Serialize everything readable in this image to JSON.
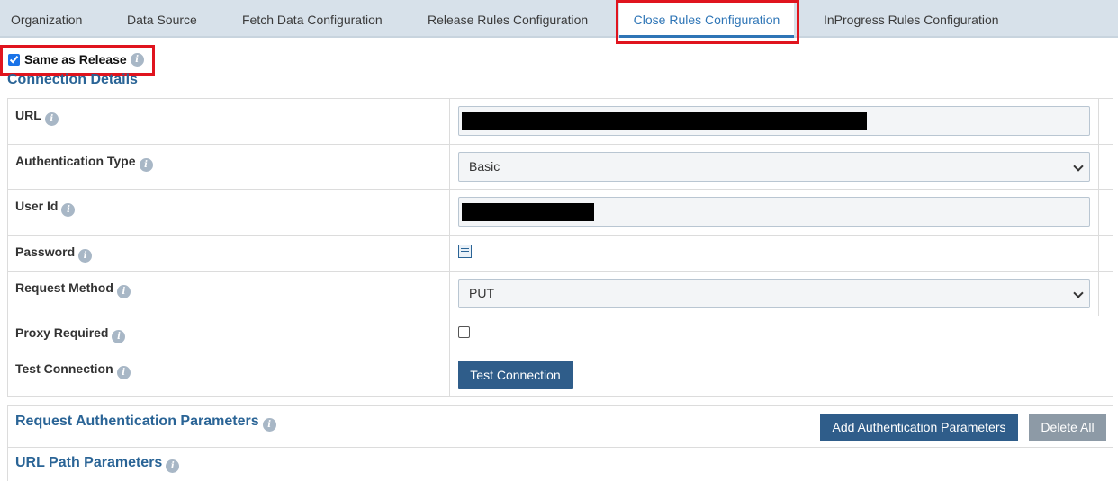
{
  "tabs": [
    {
      "label": "Organization"
    },
    {
      "label": "Data Source"
    },
    {
      "label": "Fetch Data Configuration"
    },
    {
      "label": "Release Rules Configuration"
    },
    {
      "label": "Close Rules Configuration",
      "active": true
    },
    {
      "label": "InProgress Rules Configuration"
    }
  ],
  "same_as_release": {
    "label": "Same as Release",
    "checked": true
  },
  "connection": {
    "title": "Connection Details",
    "url_label": "URL",
    "auth_type_label": "Authentication Type",
    "auth_type_value": "Basic",
    "user_id_label": "User Id",
    "password_label": "Password",
    "request_method_label": "Request Method",
    "request_method_value": "PUT",
    "proxy_label": "Proxy Required",
    "proxy_checked": false,
    "test_connection_label": "Test Connection",
    "test_connection_button": "Test Connection"
  },
  "request_auth": {
    "title": "Request Authentication Parameters",
    "add_button": "Add Authentication Parameters",
    "delete_button": "Delete All"
  },
  "url_path": {
    "title": "URL Path Parameters"
  },
  "icons": {
    "info": "info-icon",
    "password": "password-field-icon",
    "chevron": "chevron-down-icon"
  },
  "colors": {
    "accent": "#2e75b6",
    "highlight": "#e0141e",
    "primary_button": "#2f5d8a",
    "disabled_button": "#8d9aa6",
    "tabbar": "#d7e1ea"
  }
}
